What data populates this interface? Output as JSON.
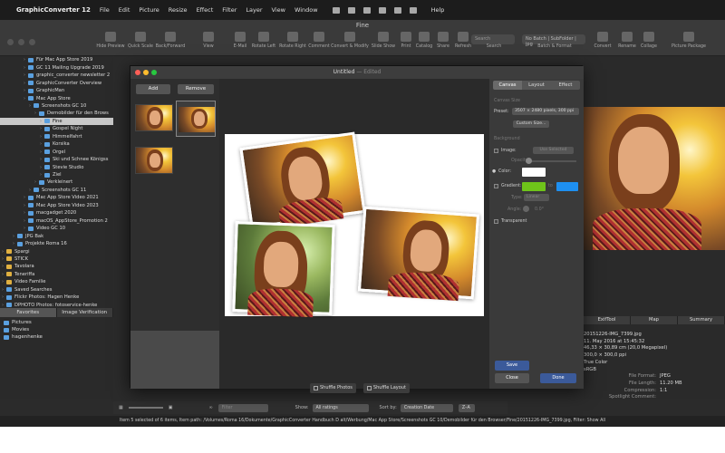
{
  "menubar": {
    "app_name": "GraphicConverter 12",
    "items": [
      "File",
      "Edit",
      "Picture",
      "Resize",
      "Effect",
      "Filter",
      "Layer",
      "View",
      "Window"
    ],
    "help": "Help"
  },
  "window": {
    "title": "Fine"
  },
  "toolbar": {
    "items": [
      "Hide Preview",
      "Quick Scale",
      "Back/Forward",
      "View",
      "E-Mail",
      "Rotate Left",
      "Rotate Right",
      "Comment",
      "Convert & Modify",
      "Slide Show",
      "Print",
      "Catalog",
      "Share",
      "Refresh",
      "Search",
      "Batch & Format",
      "Convert",
      "Rename",
      "Collage",
      "Picture Package"
    ],
    "search_placeholder": "Search",
    "batch_value": "No Batch | SubFolder | jpg"
  },
  "tree": [
    {
      "label": "Für Mac App Store 2019",
      "indent": 4
    },
    {
      "label": "GC 11 Mailing Upgrade 2019",
      "indent": 4
    },
    {
      "label": "graphic_converter newsletter 2",
      "indent": 4
    },
    {
      "label": "GraphicConverter Overview",
      "indent": 4
    },
    {
      "label": "GraphicMan",
      "indent": 4
    },
    {
      "label": "Mac App Store",
      "indent": 4
    },
    {
      "label": "Screenshots GC 10",
      "indent": 5
    },
    {
      "label": "Demobilder für den Brows",
      "indent": 6
    },
    {
      "label": "Fine",
      "indent": 7,
      "selected": true
    },
    {
      "label": "Gospel Night",
      "indent": 7
    },
    {
      "label": "Himmelfahrt",
      "indent": 7
    },
    {
      "label": "Korsika",
      "indent": 7
    },
    {
      "label": "Orgel",
      "indent": 7
    },
    {
      "label": "Ski und Schnee Königss",
      "indent": 7
    },
    {
      "label": "Stevie Studio",
      "indent": 7
    },
    {
      "label": "Ziel",
      "indent": 7
    },
    {
      "label": "Verkleinert",
      "indent": 6
    },
    {
      "label": "Screenshots GC 11",
      "indent": 5
    },
    {
      "label": "Mac App Store Video 2021",
      "indent": 4
    },
    {
      "label": "Mac App Store Video 2023",
      "indent": 4
    },
    {
      "label": "macgadget 2020",
      "indent": 4
    },
    {
      "label": "macOS_AppStore_Promotion 2",
      "indent": 4
    },
    {
      "label": "Video GC 10",
      "indent": 4
    },
    {
      "label": "JPG Bak",
      "indent": 2
    },
    {
      "label": "Projekte Roma 16",
      "indent": 2
    },
    {
      "label": "Spargi",
      "indent": 0,
      "yellow": true
    },
    {
      "label": "STICK",
      "indent": 0,
      "yellow": true
    },
    {
      "label": "Tavolara",
      "indent": 0,
      "yellow": true
    },
    {
      "label": "Teneriffa",
      "indent": 0,
      "yellow": true
    },
    {
      "label": "Video Familie",
      "indent": 0,
      "yellow": true
    },
    {
      "label": "Saved Searches",
      "indent": 0
    },
    {
      "label": "Flickr Photos: Hagen Henke",
      "indent": 0
    },
    {
      "label": "DPHOTO Photos: fotoservice-henke",
      "indent": 0
    }
  ],
  "left_tabs": [
    "Favorites",
    "Image Verification"
  ],
  "favorites": [
    "Pictures",
    "Movies",
    "hagenhenke"
  ],
  "dialog": {
    "title": "Untitled",
    "edited": "— Edited",
    "add_label": "Add",
    "remove_label": "Remove",
    "shuffle_photos": "Shuffle Photos",
    "shuffle_layout": "Shuffle Layout",
    "tabs": [
      "Canvas",
      "Layout",
      "Effect"
    ],
    "canvas_size_header": "Canvas Size",
    "preset_label": "Preset:",
    "preset_value": "3507 × 2480 pixels, 300 ppi",
    "custom_size": "Custom Size...",
    "background_header": "Background",
    "image_label": "Image:",
    "use_selected": "Use Selected",
    "opacity_label": "Opacity:",
    "color_label": "Color:",
    "gradient_label": "Gradient:",
    "to_label": "to",
    "type_label": "Type:",
    "type_value": "Linear",
    "angle_label": "Angle:",
    "angle_value": "0.0°",
    "transparent_label": "Transparent",
    "save": "Save",
    "close": "Close",
    "done": "Done",
    "gradient_from": "#6fc41a",
    "gradient_to": "#1e8ff0"
  },
  "browser_bottom": {
    "search_placeholder": "Filter",
    "show_label": "Show:",
    "show_value": "All ratings",
    "sort_label": "Sort by:",
    "sort_value": "Creation Date",
    "order_value": "Z–A"
  },
  "right_tabs": [
    "ExifTool",
    "Map",
    "Summary"
  ],
  "metadata": [
    "20151226-IMG_7399.jpg",
    "11. May 2016 at 15:45:32",
    "46,33 × 30,89 cm (20,0 Megapixel)",
    "300,0 × 300,0 ppi",
    "True Color",
    "sRGB",
    {
      "k": "File Format:",
      "v": "JPEG"
    },
    {
      "k": "File Length:",
      "v": "11.20 MB"
    },
    {
      "k": "Compression:",
      "v": "1:1"
    },
    {
      "k": "Spotlight Comment:",
      "v": ""
    }
  ],
  "status": "Item 5 selected of 6 items, Item path: /Volumes/Roma 16/Dokumente/GraphicConverter Handbuch D alt/Werbung/Mac App Store/Screenshots GC 10/Demobilder für den Browser/Fine/20151226-IMG_7399.jpg, Filter: Show All"
}
